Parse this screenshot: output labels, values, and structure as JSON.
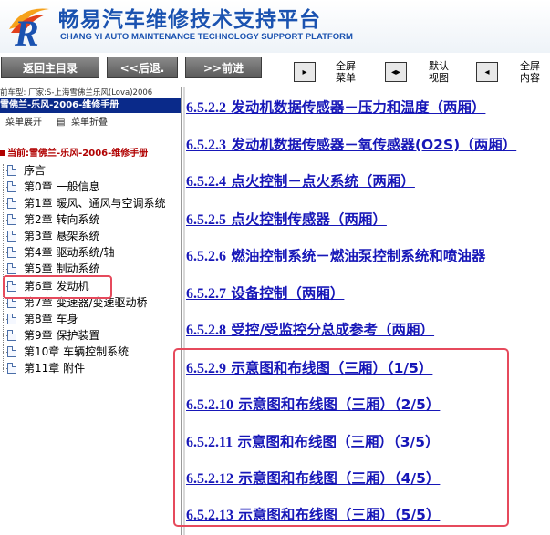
{
  "brand": {
    "title": "畅易汽车维修技术支持平台",
    "subtitle": "CHANG YI AUTO MAINTENANCE TECHNOLOGY SUPPORT PLATFORM",
    "accent_color": "#1a52b0"
  },
  "toolbar": {
    "home_label": "返回主目录",
    "back_label": "<<后退.",
    "forward_label": ">>前进",
    "fullscreen_menu_label": "全屏\n菜单",
    "default_view_label": "默认\n视图",
    "fullscreen_content_label": "全屏\n内容"
  },
  "sidebar": {
    "car_model": "前车型: 厂家:S-上海雪佛兰乐风(Lova)2006",
    "manual_title": "雪佛兰-乐风-2006-维修手册",
    "expand_label": "菜单展开",
    "collapse_label": "菜单折叠",
    "current_label": "当前:雪佛兰-乐风-2006-维修手册",
    "items": [
      {
        "label": "序言"
      },
      {
        "label": "第0章 一般信息"
      },
      {
        "label": "第1章 暖风、通风与空调系统"
      },
      {
        "label": "第2章 转向系统"
      },
      {
        "label": "第3章 悬架系统"
      },
      {
        "label": "第4章 驱动系统/轴"
      },
      {
        "label": "第5章 制动系统"
      },
      {
        "label": "第6章 发动机"
      },
      {
        "label": "第7章 变速器/变速驱动桥"
      },
      {
        "label": "第8章 车身"
      },
      {
        "label": "第9章 保护装置"
      },
      {
        "label": "第10章 车辆控制系统"
      },
      {
        "label": "第11章 附件"
      }
    ],
    "highlight_color": "#e64a5c"
  },
  "content": {
    "links": [
      {
        "num": "6.5.2.2",
        "text": " 发动机数据传感器－压力和温度（两厢）"
      },
      {
        "num": "6.5.2.3",
        "text": " 发动机数据传感器－氧传感器(O2S)（两厢）"
      },
      {
        "num": "6.5.2.4",
        "text": " 点火控制－点火系统（两厢）"
      },
      {
        "num": "6.5.2.5",
        "text": " 点火控制传感器（两厢）"
      },
      {
        "num": "6.5.2.6",
        "text": " 燃油控制系统－燃油泵控制系统和喷油器"
      },
      {
        "num": "6.5.2.7",
        "text": " 设备控制（两厢）"
      },
      {
        "num": "6.5.2.8",
        "text": " 受控/受监控分总成参考（两厢）"
      },
      {
        "num": "6.5.2.9",
        "text": " 示意图和布线图（三厢）（1/5）"
      },
      {
        "num": "6.5.2.10",
        "text": " 示意图和布线图（三厢）（2/5）"
      },
      {
        "num": "6.5.2.11",
        "text": " 示意图和布线图（三厢）（3/5）"
      },
      {
        "num": "6.5.2.12",
        "text": " 示意图和布线图（三厢）（4/5）"
      },
      {
        "num": "6.5.2.13",
        "text": " 示意图和布线图（三厢）（5/5）"
      }
    ],
    "link_color": "#1717b8"
  }
}
